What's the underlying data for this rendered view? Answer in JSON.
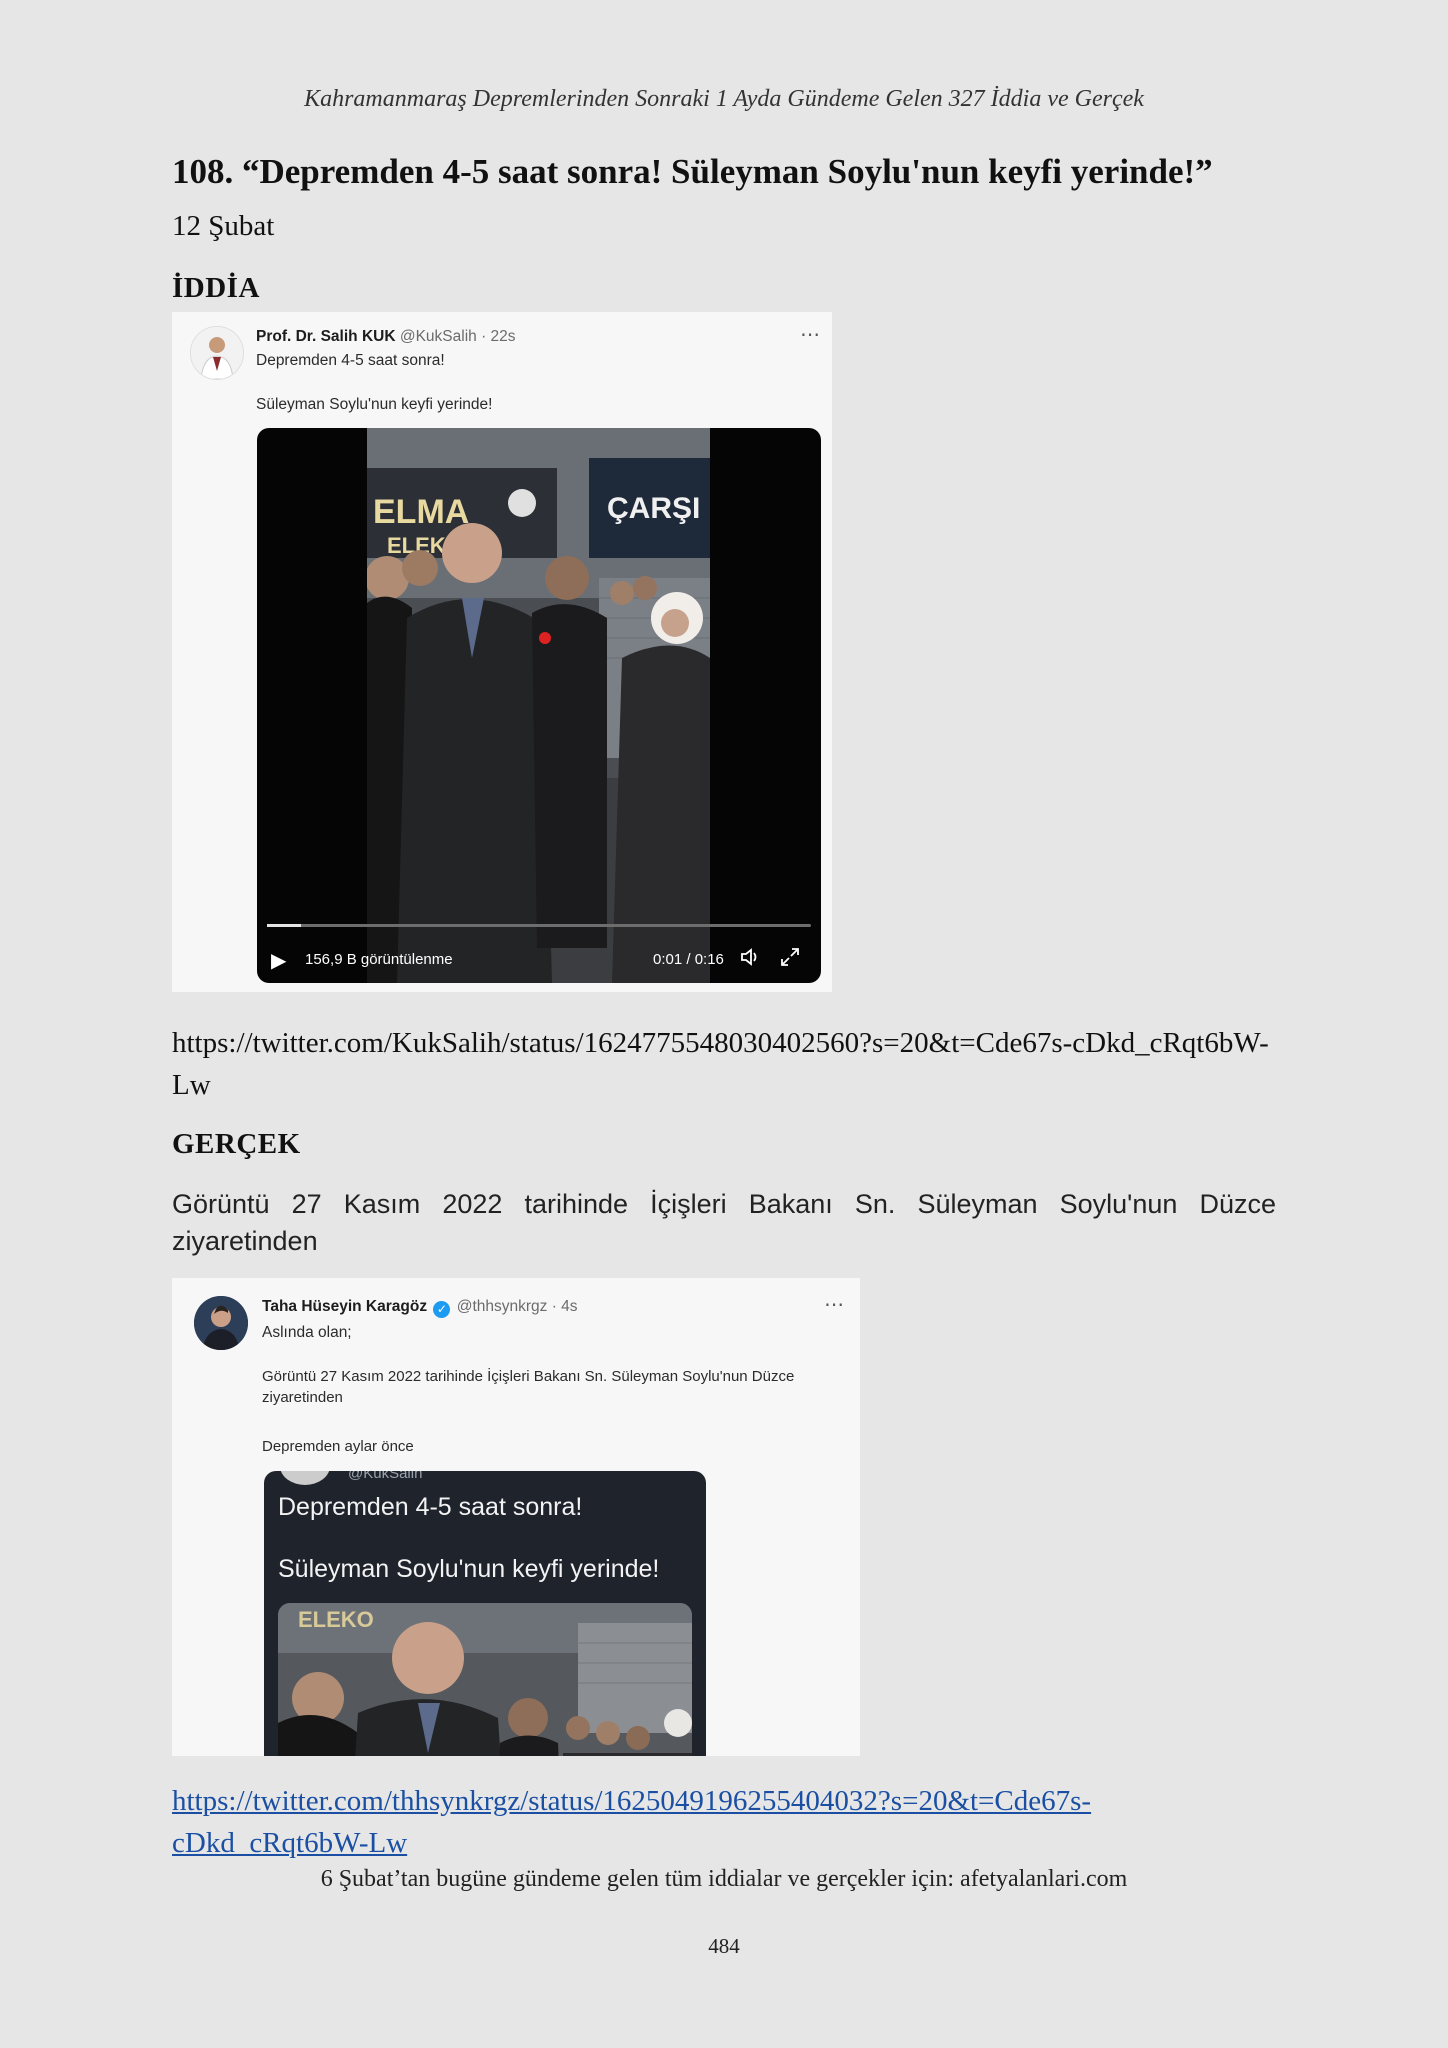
{
  "running_head": "Kahramanmaraş Depremlerinden Sonraki 1 Ayda Gündeme Gelen 327 İddia ve Gerçek",
  "entry": {
    "heading": "108. “Depremden 4-5 saat sonra! Süleyman Soylu'nun keyfi yerinde!”",
    "date": "12 Şubat"
  },
  "claim": {
    "label": "İDDİA",
    "tweet": {
      "author": "Prof. Dr. Salih KUK",
      "handle": "@KukSalih",
      "time": "· 22s",
      "line1": "Depremden 4-5 saat sonra!",
      "line2": "Süleyman Soylu'nun keyfi yerinde!",
      "video": {
        "views": "156,9 B görüntülenme",
        "time": "0:01 / 0:16",
        "progress": 0.0625,
        "sign_left": "ELMA",
        "sign_left2": "ELEKOM",
        "sign_right": "ÇARŞI"
      }
    },
    "url": "https://twitter.com/KukSalih/status/1624775548030402560?s=20&t=Cde67s-cDkd_cRqt6bW-Lw"
  },
  "fact": {
    "label": "GERÇEK",
    "text": "Görüntü 27 Kasım 2022 tarihinde İçişleri Bakanı Sn. Süleyman Soylu'nun Düzce ziyaretinden",
    "tweet": {
      "author": "Taha Hüseyin Karagöz",
      "handle": "@thhsynkrgz",
      "time": "· 4s",
      "line1": "Aslında olan;",
      "line2": "Görüntü 27 Kasım 2022 tarihinde İçişleri Bakanı Sn. Süleyman Soylu'nun Düzce ziyaretinden",
      "line3": "Depremden aylar önce",
      "quoted": {
        "handle": "@KukSalih",
        "line1": "Depremden 4-5 saat sonra!",
        "line2": "Süleyman Soylu'nun keyfi yerinde!",
        "sign": "ELEKO"
      }
    },
    "url": "https://twitter.com/thhsynkrgz/status/1625049196255404032?s=20&t=Cde67s-cDkd_cRqt6bW-Lw"
  },
  "footer_note": "6 Şubat’tan bugüne gündeme gelen tüm iddialar ve gerçekler için: afetyalanlari.com",
  "page_number": "484"
}
